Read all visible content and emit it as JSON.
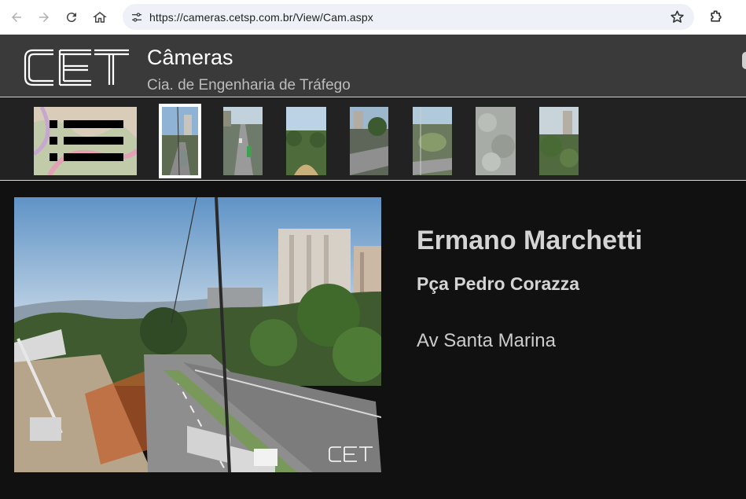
{
  "browser": {
    "url": "https://cameras.cetsp.com.br/View/Cam.aspx",
    "icons": [
      "back-icon",
      "forward-icon",
      "reload-icon",
      "home-icon",
      "site-info-icon",
      "bookmark-star-icon",
      "extensions-icon"
    ]
  },
  "header": {
    "logo_text": "CET",
    "title": "Câmeras",
    "subtitle": "Cia. de Engenharia de Tráfego"
  },
  "thumbnails": {
    "selected_index": 1,
    "count": 8
  },
  "camera": {
    "title": "Ermano Marchetti",
    "subtitle": "Pça Pedro Corazza",
    "street": "Av Santa Marina",
    "watermark": "CET"
  },
  "colors": {
    "header_bg": "#3a3a3a",
    "strip_bg": "#222222",
    "page_bg": "#111111",
    "text_light": "#d4d4d4"
  }
}
